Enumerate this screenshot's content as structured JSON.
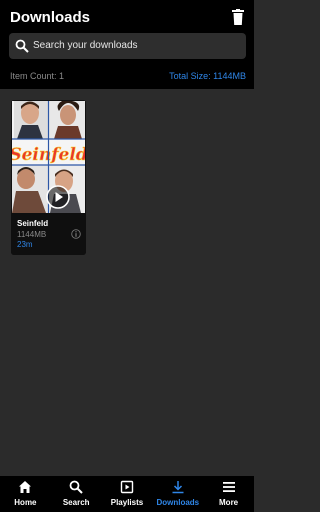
{
  "header": {
    "title": "Downloads",
    "search_placeholder": "Search your downloads",
    "item_count": "Item Count: 1",
    "total_size": "Total Size: 1144MB"
  },
  "download": {
    "title": "Seinfeld",
    "size": "1144MB",
    "duration": "23m",
    "logo_text": "Seinfeld"
  },
  "tabs": [
    {
      "label": "Home",
      "icon": "home-icon"
    },
    {
      "label": "Search",
      "icon": "search-icon"
    },
    {
      "label": "Playlists",
      "icon": "playlist-icon"
    },
    {
      "label": "Downloads",
      "icon": "download-icon"
    },
    {
      "label": "More",
      "icon": "menu-icon"
    }
  ],
  "colors": {
    "accent": "#2f86e8",
    "background": "#2b2b2b",
    "bar": "#000000"
  }
}
